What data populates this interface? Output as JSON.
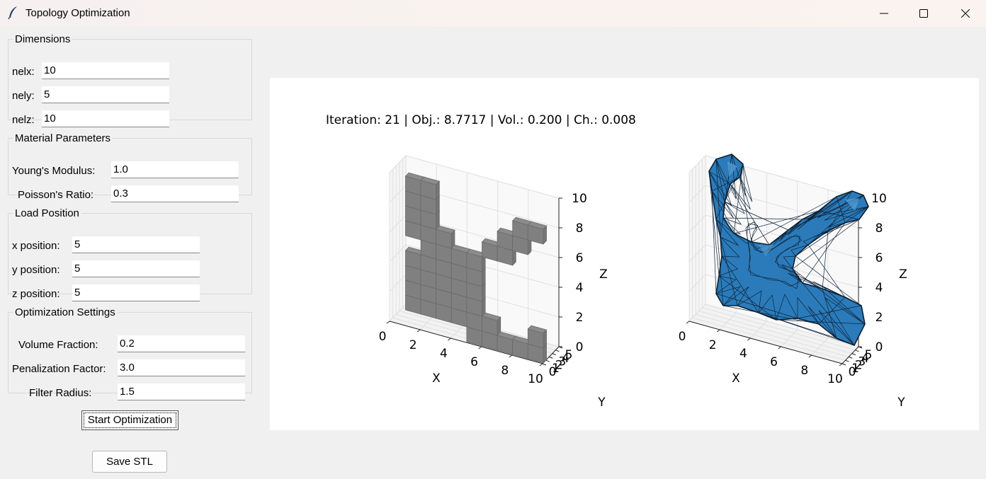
{
  "window": {
    "title": "Topology Optimization",
    "icon": "feather-icon",
    "controls": [
      "minimize-icon",
      "maximize-icon",
      "close-icon"
    ]
  },
  "dimensions": {
    "legend": "Dimensions",
    "fields": [
      {
        "label": "nelx:",
        "value": "10"
      },
      {
        "label": "nely:",
        "value": "5"
      },
      {
        "label": "nelz:",
        "value": "10"
      }
    ]
  },
  "material": {
    "legend": "Material Parameters",
    "fields": [
      {
        "label": "Young's Modulus:",
        "value": "1.0"
      },
      {
        "label": "Poisson's Ratio:",
        "value": "0.3"
      }
    ]
  },
  "load": {
    "legend": "Load Position",
    "fields": [
      {
        "label": "x position:",
        "value": "5"
      },
      {
        "label": "y position:",
        "value": "5"
      },
      {
        "label": "z position:",
        "value": "5"
      }
    ]
  },
  "optimization": {
    "legend": "Optimization Settings",
    "fields": [
      {
        "label": "Volume Fraction:",
        "value": "0.2"
      },
      {
        "label": "Penalization Factor:",
        "value": "3.0"
      },
      {
        "label": "Filter Radius:",
        "value": "1.5"
      }
    ]
  },
  "buttons": {
    "start": "Start Optimization",
    "save": "Save STL"
  },
  "plot": {
    "status": "Iteration: 21 | Obj.: 8.7717 | Vol.: 0.200 | Ch.: 0.008",
    "voxel_color": "#808080",
    "mesh_color": "#2b7bba"
  },
  "chart_data": [
    {
      "type": "3d-voxel",
      "xlabel": "X",
      "ylabel": "Y",
      "zlabel": "Z",
      "xticks": [
        "0",
        "2",
        "4",
        "6",
        "8",
        "10"
      ],
      "yticks": [
        "0",
        "1",
        "2",
        "3",
        "4",
        "5"
      ],
      "zticks": [
        "0",
        "2",
        "4",
        "6",
        "8",
        "10"
      ],
      "xlim": [
        0,
        10
      ],
      "ylim": [
        0,
        5
      ],
      "zlim": [
        0,
        10
      ]
    },
    {
      "type": "3d-mesh",
      "xlabel": "X",
      "ylabel": "Y",
      "zlabel": "Z",
      "xticks": [
        "0",
        "2",
        "4",
        "6",
        "8",
        "10"
      ],
      "yticks": [
        "0",
        "1",
        "2",
        "3",
        "4",
        "5"
      ],
      "zticks": [
        "0",
        "2",
        "4",
        "6",
        "8",
        "10"
      ],
      "xlim": [
        0,
        10
      ],
      "ylim": [
        0,
        5
      ],
      "zlim": [
        0,
        10
      ]
    }
  ]
}
